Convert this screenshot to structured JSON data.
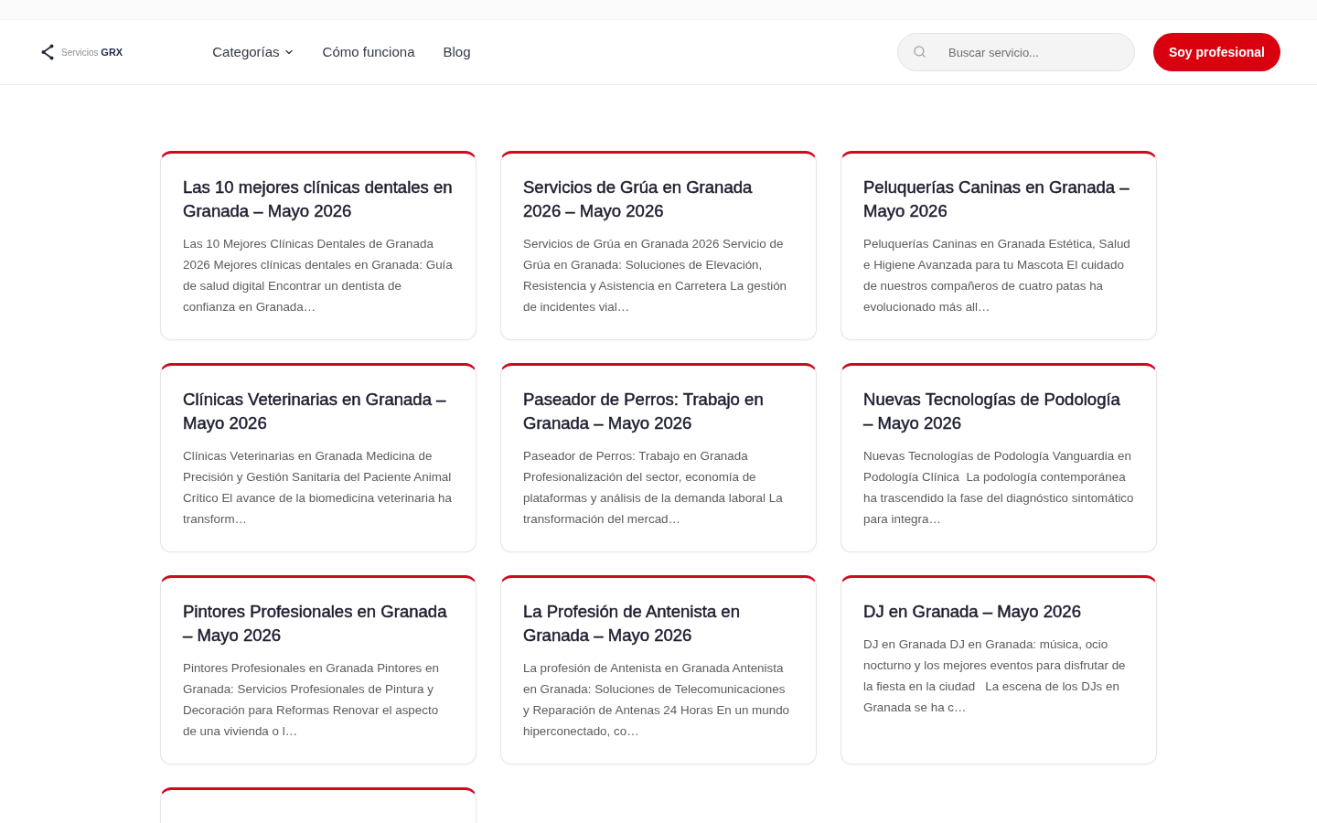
{
  "header": {
    "logo": "Servicios **GRX**",
    "nav": [
      {
        "label": "Categorías",
        "kind": "dropdown"
      },
      {
        "label": "Cómo funciona",
        "kind": "link"
      },
      {
        "label": "Blog",
        "kind": "link"
      }
    ],
    "search": {
      "placeholder": "Buscar servicio..."
    },
    "cta": "Soy profesional"
  },
  "posts": [
    {
      "title": "Las 10 mejores clínicas dentales en Granada – Mayo 2026",
      "excerpt": "Las 10 Mejores Clínicas Dentales de Granada 2026 Mejores clínicas dentales en Granada: Guía de salud digital Encontrar un dentista de confianza en Granada…"
    },
    {
      "title": "Servicios de Grúa en Granada 2026 – Mayo 2026",
      "excerpt": "Servicios de Grúa en Granada 2026 Servicio de Grúa en Granada: Soluciones de Elevación, Resistencia y Asistencia en Carretera La gestión de incidentes vial…"
    },
    {
      "title": "Peluquerías Caninas en Granada – Mayo 2026",
      "excerpt": "Peluquerías Caninas en Granada Estética, Salud e Higiene Avanzada para tu Mascota El cuidado de nuestros compañeros de cuatro patas ha evolucionado más all…"
    },
    {
      "title": "Clínicas Veterinarias en Granada – Mayo 2026",
      "excerpt": "Clínicas Veterinarias en Granada Medicina de Precisión y Gestión Sanitaria del Paciente Animal Crítico El avance de la biomedicina veterinaria ha transform…"
    },
    {
      "title": "Paseador de Perros: Trabajo en Granada – Mayo 2026",
      "excerpt": "Paseador de Perros: Trabajo en Granada Profesionalización del sector, economía de plataformas y análisis de la demanda laboral La transformación del mercad…"
    },
    {
      "title": "Nuevas Tecnologías de Podología – Mayo 2026",
      "excerpt": "Nuevas Tecnologías de Podología Vanguardia en Podología Clínica  La podología contemporánea ha trascendido la fase del diagnóstico sintomático para integra…"
    },
    {
      "title": "Pintores Profesionales en Granada – Mayo 2026",
      "excerpt": "Pintores Profesionales en Granada Pintores en Granada: Servicios Profesionales de Pintura y Decoración para Reformas Renovar el aspecto de una vivienda o l…"
    },
    {
      "title": "La Profesión de Antenista en Granada – Mayo 2026",
      "excerpt": "La profesión de Antenista en Granada Antenista en Granada: Soluciones de Telecomunicaciones y Reparación de Antenas 24 Horas En un mundo hiperconectado, co…"
    },
    {
      "title": "DJ en Granada – Mayo 2026",
      "excerpt": "DJ en Granada DJ en Granada: música, ocio nocturno y los mejores eventos para disfrutar de la fiesta en la ciudad   La escena de los DJs en Granada se ha c…"
    }
  ],
  "more_posts_below": true
}
